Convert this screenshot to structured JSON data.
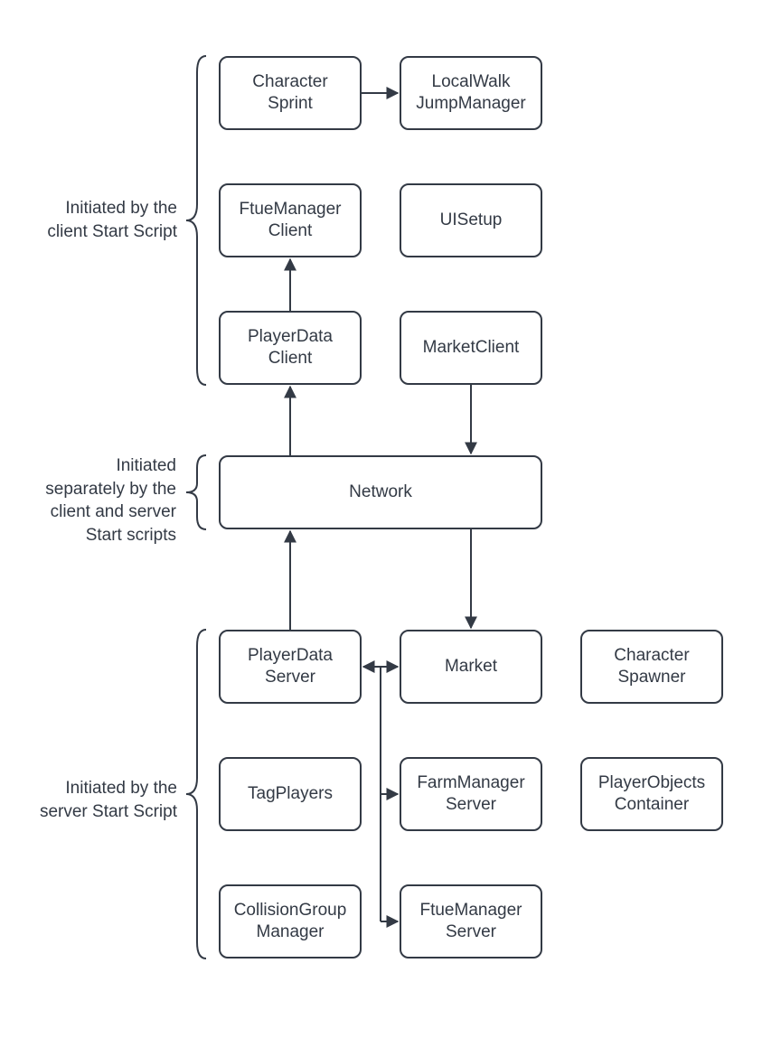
{
  "labels": {
    "client": "Initiated by the\nclient Start Script",
    "network": "Initiated\nseparately by the\nclient and server\nStart scripts",
    "server": "Initiated by the\nserver Start Script"
  },
  "nodes": {
    "characterSprint": "Character\nSprint",
    "localWalkJump": "LocalWalk\nJumpManager",
    "ftueManagerClient": "FtueManager\nClient",
    "uiSetup": "UISetup",
    "playerDataClient": "PlayerData\nClient",
    "marketClient": "MarketClient",
    "network": "Network",
    "playerDataServer": "PlayerData\nServer",
    "market": "Market",
    "characterSpawner": "Character\nSpawner",
    "tagPlayers": "TagPlayers",
    "farmManagerServer": "FarmManager\nServer",
    "playerObjectsContainer": "PlayerObjects\nContainer",
    "collisionGroupManager": "CollisionGroup\nManager",
    "ftueManagerServer": "FtueManager\nServer"
  }
}
